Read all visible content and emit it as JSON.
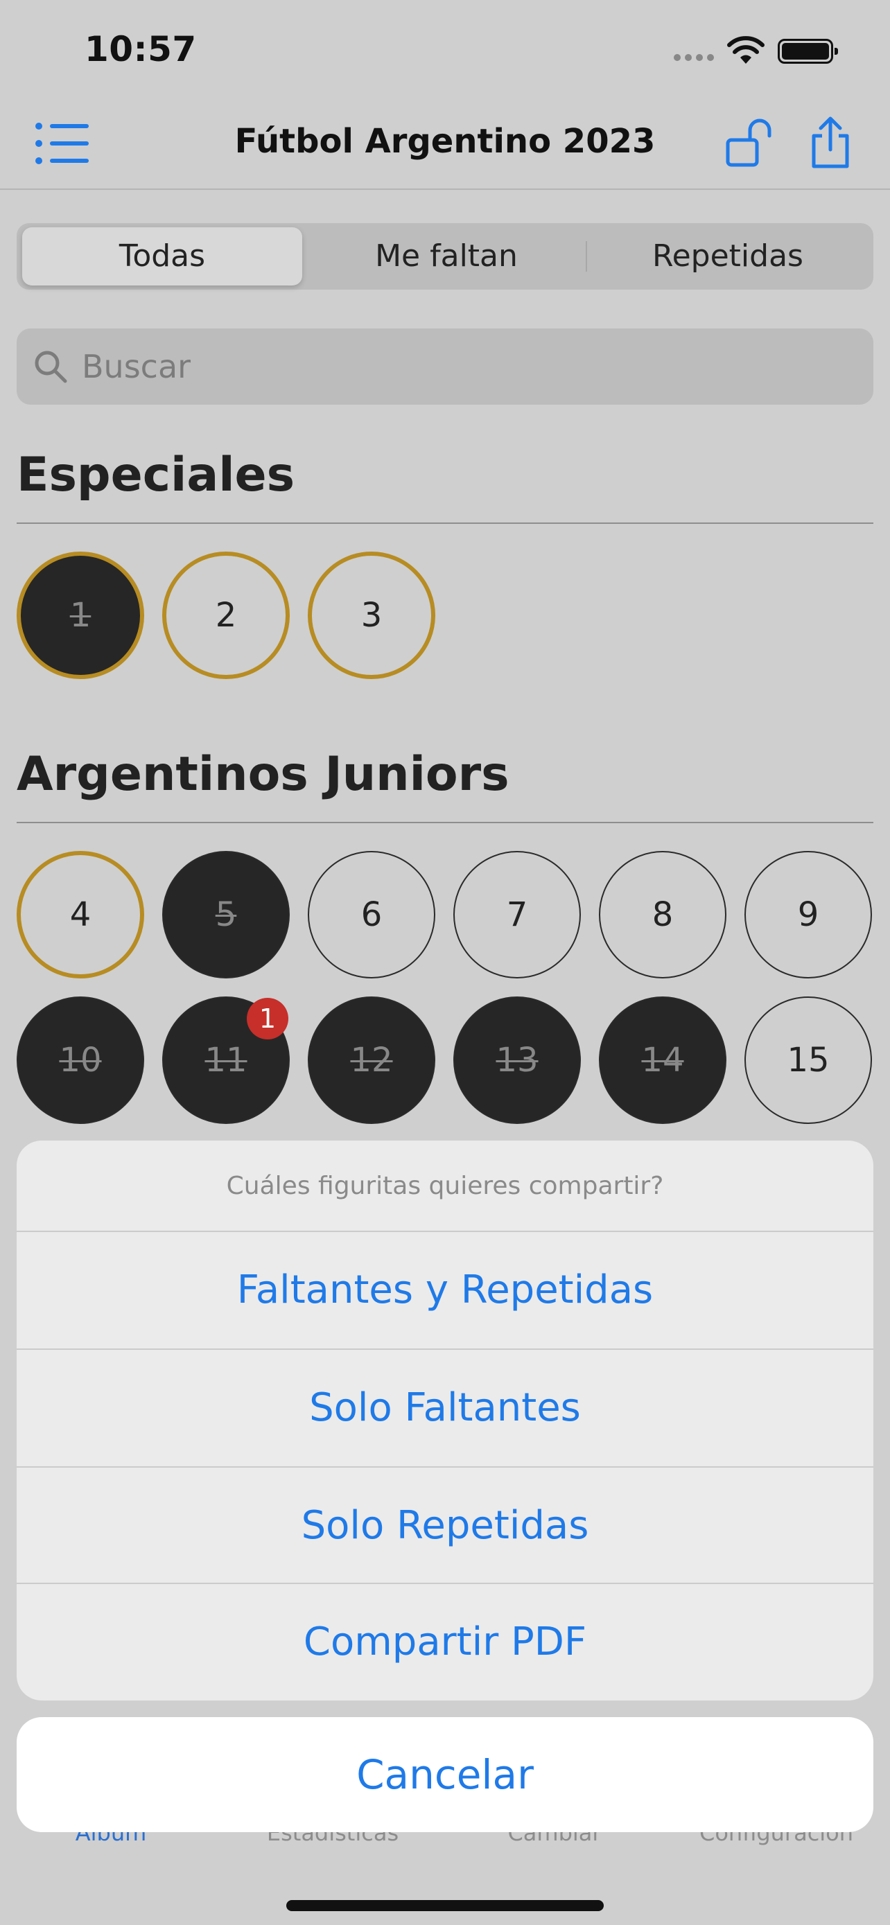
{
  "status_bar": {
    "time": "10:57"
  },
  "nav": {
    "title": "Fútbol Argentino 2023",
    "menu_icon": "list-icon",
    "lock_icon": "unlock-icon",
    "share_icon": "share-icon"
  },
  "segments": [
    "Todas",
    "Me faltan",
    "Repetidas"
  ],
  "selected_segment": "Todas",
  "search": {
    "placeholder": "Buscar"
  },
  "sections": [
    {
      "title": "Especiales",
      "stickers": [
        {
          "label": "1",
          "owned": true,
          "special": true
        },
        {
          "label": "2",
          "owned": false,
          "special": true
        },
        {
          "label": "3",
          "owned": false,
          "special": true
        }
      ]
    },
    {
      "title": "Argentinos Juniors",
      "stickers": [
        {
          "label": "4",
          "owned": false,
          "special": true
        },
        {
          "label": "5",
          "owned": true
        },
        {
          "label": "6",
          "owned": false
        },
        {
          "label": "7",
          "owned": false
        },
        {
          "label": "8",
          "owned": false
        },
        {
          "label": "9",
          "owned": false
        },
        {
          "label": "10",
          "owned": true
        },
        {
          "label": "11",
          "owned": true,
          "badge": "1"
        },
        {
          "label": "12",
          "owned": true
        },
        {
          "label": "13",
          "owned": true
        },
        {
          "label": "14",
          "owned": true
        },
        {
          "label": "15",
          "owned": false
        }
      ]
    }
  ],
  "action_sheet": {
    "title": "Cuáles figuritas quieres compartir?",
    "options": [
      "Faltantes y Repetidas",
      "Solo Faltantes",
      "Solo Repetidas",
      "Compartir PDF"
    ],
    "cancel": "Cancelar"
  },
  "tab_bar": [
    "Álbum",
    "Estadísticas",
    "Cambiar",
    "Configuración"
  ],
  "colors": {
    "accent": "#1f7ae8",
    "gold": "#b78c22",
    "owned_fill": "#262626",
    "badge": "#c62f2a"
  }
}
